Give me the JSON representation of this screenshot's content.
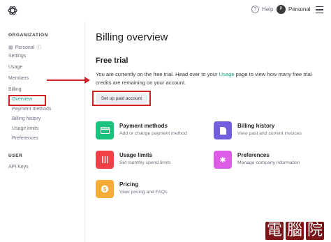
{
  "topbar": {
    "help_label": "Help",
    "account_label": "Personal",
    "avatar_initial": "P"
  },
  "sidebar": {
    "organization_heading": "ORGANIZATION",
    "personal_label": "Personal",
    "items": [
      {
        "label": "Settings"
      },
      {
        "label": "Usage"
      },
      {
        "label": "Members"
      },
      {
        "label": "Billing"
      }
    ],
    "billing_sub": [
      {
        "label": "Overview",
        "active": true
      },
      {
        "label": "Payment methods"
      },
      {
        "label": "Billing history"
      },
      {
        "label": "Usage limits"
      },
      {
        "label": "Preferences"
      }
    ],
    "user_heading": "USER",
    "api_keys_label": "API Keys"
  },
  "main": {
    "title": "Billing overview",
    "free_trial_title": "Free trial",
    "trial_text_before": "You are currently on the free trial. Head over to your ",
    "trial_text_link": "Usage",
    "trial_text_after": " page to view how many free trial credits are remaining on your account.",
    "setup_button": "Set up paid account",
    "cards": [
      {
        "title": "Payment methods",
        "desc": "Add or change payment method",
        "color": "#19c37d",
        "icon": "credit-card-icon"
      },
      {
        "title": "Billing history",
        "desc": "View past and current invoices",
        "color": "#715fde",
        "icon": "document-icon"
      },
      {
        "title": "Usage limits",
        "desc": "Set monthly spend limits",
        "color": "#ef4146",
        "icon": "sliders-icon"
      },
      {
        "title": "Preferences",
        "desc": "Manage company information",
        "color": "#dd5ce5",
        "icon": "gear-icon"
      },
      {
        "title": "Pricing",
        "desc": "View pricing and FAQs",
        "color": "#f4ac36",
        "icon": "dollar-icon"
      }
    ]
  },
  "watermark": [
    "電",
    "腦",
    "院"
  ],
  "colors": {
    "accent": "#10a37f",
    "highlight": "#d21f25"
  }
}
